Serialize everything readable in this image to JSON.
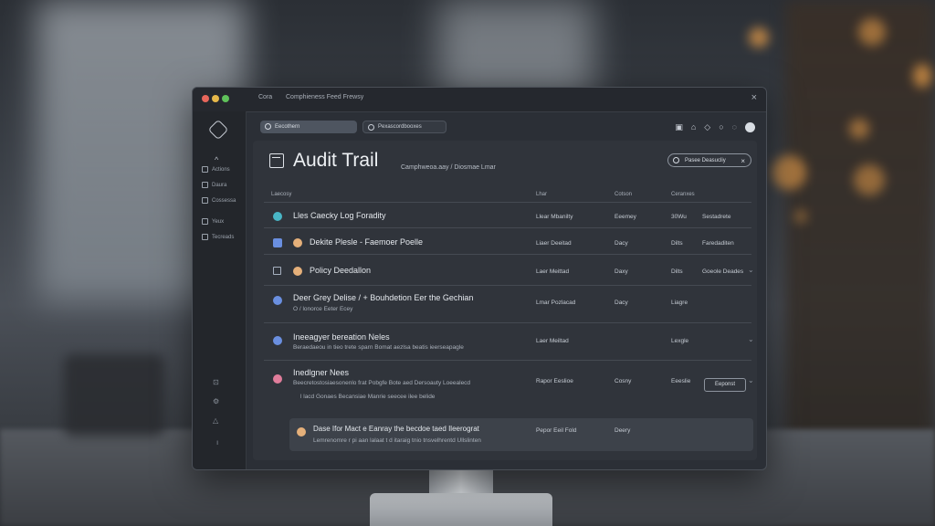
{
  "window": {
    "tab1": "Cora",
    "tab2": "Comphieness Feed Frewsy",
    "close": "×"
  },
  "sidebar": {
    "items": [
      {
        "label": "Actions"
      },
      {
        "label": "Daura"
      },
      {
        "label": "Cossessa"
      },
      {
        "label": "Yeux"
      },
      {
        "label": "Tecreads"
      }
    ]
  },
  "toolbar": {
    "search_label": "Eecothern",
    "filter_label": "Pexascordbooxes"
  },
  "header": {
    "title": "Audit Trail",
    "crumb": "Camphweoa.aay  /  Diosmae Lmar",
    "filter_pill": "Pasee Deasucliy",
    "filter_close": "×"
  },
  "columns": [
    "Laecosy",
    "Lhar",
    "Cotson",
    "Ceranxes"
  ],
  "rows": [
    {
      "title": "Lles Caecky Log Foradity",
      "sub": "",
      "c1": "Llear Mbanilty",
      "c2": "Eeemey",
      "c3": "30Wu",
      "c4": "Sestadrete"
    },
    {
      "title": "Dekite Plesle - Faemoer Poelle",
      "sub": "",
      "c1": "Liaer Deeitad",
      "c2": "Dacy",
      "c3": "Dilts",
      "c4": "Faredaditen"
    },
    {
      "title": "Policy Deedallon",
      "sub": "",
      "c1": "Laer Meittad",
      "c2": "Daxy",
      "c3": "Dilts",
      "c4": "Goeole Deades"
    },
    {
      "title": "Deer Grey Delise / + Bouhdetion Eer the Gechian",
      "sub": "O / lonorce Eeter Ecey",
      "c1": "Lmar Pozlacad",
      "c2": "Dacy",
      "c3": "Liagre",
      "c4": ""
    },
    {
      "title": "Ineeagyer bereation Neles",
      "sub": "Beraedaeou in tieo trete sparn Bomat aezlsa beatis ieerseapagle",
      "c1": "Laer Meiltad",
      "c2": "",
      "c3": "Lexgle",
      "c4": ""
    },
    {
      "title": "Inedlgner Nees",
      "sub": "Beecretostosiaesonenlo frat Pobgfe Bote aed Dersoauty Loeealecd",
      "sub2": "l lacd Gonaes Becansiae Manrie seecee ilee belide",
      "c1": "Rapor Eeslioe",
      "c2": "Cosny",
      "c3": "Eeeslie",
      "c4": "Eeponst"
    },
    {
      "title": "Dase Ifor Mact e Eanray the becdoe taed Ileerograt",
      "sub": "Lemrenomre r pi aan lalaat t d itaraig tnio tnsvelhrentd Ullslinten",
      "c1": "Pepor Eeil Fold",
      "c2": "Deery",
      "c3": "",
      "c4": ""
    }
  ],
  "icons": {
    "accent_teal": "#49b6c6",
    "accent_blue": "#6a8fe0",
    "accent_pink": "#e07d9b",
    "accent_orange": "#e5b07a"
  }
}
